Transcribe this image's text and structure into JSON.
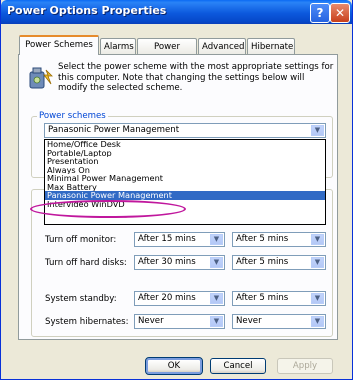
{
  "window": {
    "title": "Power Options Properties",
    "help": "?",
    "close": "✕"
  },
  "tabs": [
    {
      "label": "Power Schemes"
    },
    {
      "label": "Alarms"
    },
    {
      "label": "Power Meter"
    },
    {
      "label": "Advanced"
    },
    {
      "label": "Hibernate"
    }
  ],
  "description": "Select the power scheme with the most appropriate settings for this computer. Note that changing the settings below will modify the selected scheme.",
  "power_schemes": {
    "group_label": "Power schemes",
    "selected": "Panasonic Power Management",
    "options": [
      "Home/Office Desk",
      "Portable/Laptop",
      "Presentation",
      "Always On",
      "Minimal Power Management",
      "Max Battery",
      "Panasonic Power Management",
      "Intervideo WinDVD"
    ],
    "highlighted": "Panasonic Power Management"
  },
  "settings": {
    "rows": [
      {
        "label": "Turn off monitor:",
        "col1": "After 15 mins",
        "col2": "After 5 mins"
      },
      {
        "label": "Turn off hard disks:",
        "col1": "After 30 mins",
        "col2": "After 5 mins"
      },
      {
        "label": "System standby:",
        "col1": "After 20 mins",
        "col2": "After 5 mins"
      },
      {
        "label": "System hibernates:",
        "col1": "Never",
        "col2": "Never"
      }
    ]
  },
  "buttons": {
    "ok": "OK",
    "cancel": "Cancel",
    "apply": "Apply"
  }
}
